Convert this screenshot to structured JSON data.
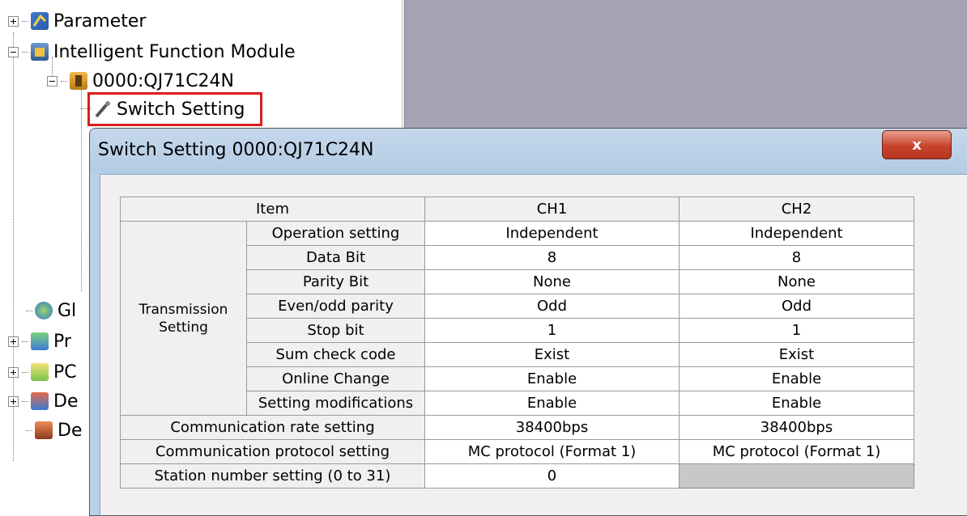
{
  "tree": {
    "items": [
      {
        "label": "Parameter",
        "icon": "parameter-icon",
        "expander": "plus"
      },
      {
        "label": "Intelligent Function Module",
        "icon": "module-icon",
        "expander": "minus"
      },
      {
        "label": "0000:QJ71C24N",
        "icon": "module-unit-icon",
        "expander": "minus"
      },
      {
        "label": "Switch Setting",
        "icon": "wrench-icon",
        "expander": "none"
      }
    ],
    "partial_items": [
      "Gl",
      "Pr",
      "PC",
      "De",
      "De"
    ]
  },
  "dialog": {
    "title": "Switch Setting 0000:QJ71C24N",
    "close_label": "x"
  },
  "table": {
    "headers": {
      "item": "Item",
      "ch1": "CH1",
      "ch2": "CH2"
    },
    "group_label_line1": "Transmission",
    "group_label_line2": "Setting",
    "group_rows": [
      {
        "label": "Operation setting",
        "ch1": "Independent",
        "ch2": "Independent"
      },
      {
        "label": "Data Bit",
        "ch1": "8",
        "ch2": "8"
      },
      {
        "label": "Parity Bit",
        "ch1": "None",
        "ch2": "None"
      },
      {
        "label": "Even/odd parity",
        "ch1": "Odd",
        "ch2": "Odd"
      },
      {
        "label": "Stop bit",
        "ch1": "1",
        "ch2": "1"
      },
      {
        "label": "Sum check code",
        "ch1": "Exist",
        "ch2": "Exist"
      },
      {
        "label": "Online Change",
        "ch1": "Enable",
        "ch2": "Enable"
      },
      {
        "label": "Setting modifications",
        "ch1": "Enable",
        "ch2": "Enable"
      }
    ],
    "single_rows": [
      {
        "label": "Communication rate setting",
        "ch1": "38400bps",
        "ch2": "38400bps"
      },
      {
        "label": "Communication protocol setting",
        "ch1": "MC protocol (Format 1)",
        "ch2": "MC protocol (Format 1)"
      },
      {
        "label": "Station number setting (0 to 31)",
        "ch1": "0",
        "ch2": ""
      }
    ]
  },
  "colors": {
    "highlight": "#e01c1c",
    "right_panel": "#a3a3b5",
    "title_bar": "#bcd1e8",
    "close_button": "#c8432d"
  }
}
